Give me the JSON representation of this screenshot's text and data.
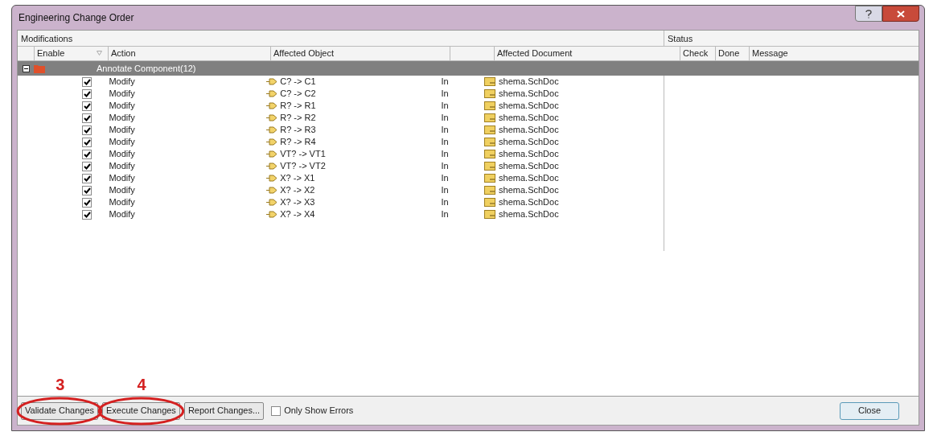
{
  "window": {
    "title": "Engineering Change Order"
  },
  "groups": [
    "Modifications",
    "Status"
  ],
  "columns": [
    "Enable",
    "Action",
    "Affected Object",
    "Affected Document",
    "Check",
    "Done",
    "Message"
  ],
  "section": {
    "label": "Annotate Component(12)",
    "expanded": true
  },
  "rows": [
    {
      "enabled": true,
      "action": "Modify",
      "object": "C? -> C1",
      "direction": "In",
      "document": "shema.SchDoc"
    },
    {
      "enabled": true,
      "action": "Modify",
      "object": "C? -> C2",
      "direction": "In",
      "document": "shema.SchDoc"
    },
    {
      "enabled": true,
      "action": "Modify",
      "object": "R? -> R1",
      "direction": "In",
      "document": "shema.SchDoc"
    },
    {
      "enabled": true,
      "action": "Modify",
      "object": "R? -> R2",
      "direction": "In",
      "document": "shema.SchDoc"
    },
    {
      "enabled": true,
      "action": "Modify",
      "object": "R? -> R3",
      "direction": "In",
      "document": "shema.SchDoc"
    },
    {
      "enabled": true,
      "action": "Modify",
      "object": "R? -> R4",
      "direction": "In",
      "document": "shema.SchDoc"
    },
    {
      "enabled": true,
      "action": "Modify",
      "object": "VT? -> VT1",
      "direction": "In",
      "document": "shema.SchDoc"
    },
    {
      "enabled": true,
      "action": "Modify",
      "object": "VT? -> VT2",
      "direction": "In",
      "document": "shema.SchDoc"
    },
    {
      "enabled": true,
      "action": "Modify",
      "object": "X? -> X1",
      "direction": "In",
      "document": "shema.SchDoc"
    },
    {
      "enabled": true,
      "action": "Modify",
      "object": "X? -> X2",
      "direction": "In",
      "document": "shema.SchDoc"
    },
    {
      "enabled": true,
      "action": "Modify",
      "object": "X? -> X3",
      "direction": "In",
      "document": "shema.SchDoc"
    },
    {
      "enabled": true,
      "action": "Modify",
      "object": "X? -> X4",
      "direction": "In",
      "document": "shema.SchDoc"
    }
  ],
  "buttons": [
    {
      "label": "Validate Changes",
      "annotation": "3"
    },
    {
      "label": "Execute Changes",
      "annotation": "4"
    },
    {
      "label": "Report Changes..."
    }
  ],
  "only_show_errors": {
    "label": "Only Show Errors",
    "checked": false
  },
  "close_button": "Close"
}
